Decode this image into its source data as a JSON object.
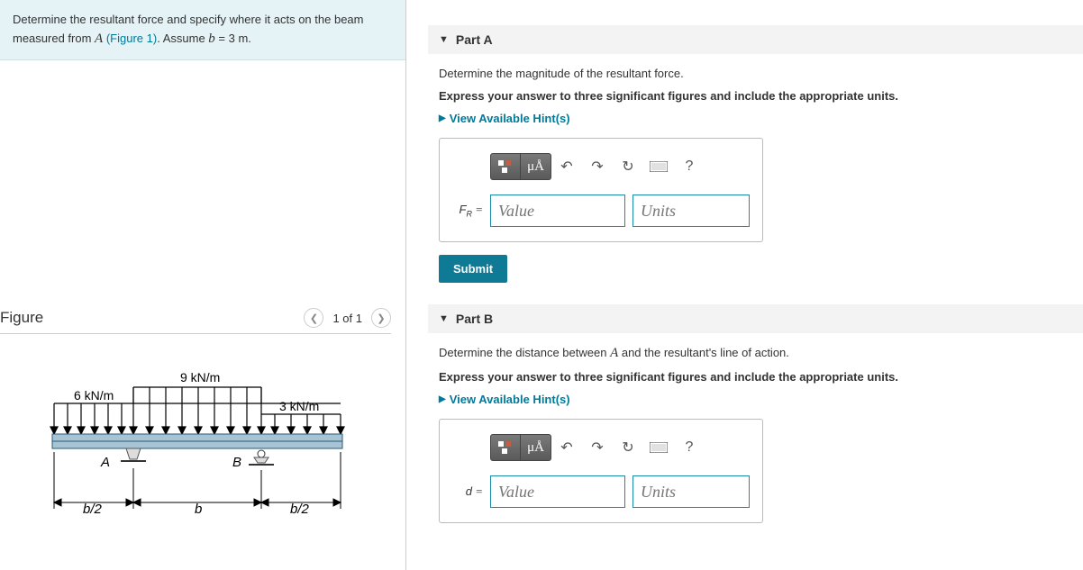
{
  "problem": {
    "text_1": "Determine the resultant force and specify where it acts on the beam measured from ",
    "fig_label": "(Figure 1)",
    "text_2": ". Assume ",
    "b_eq": "b = 3 m",
    "period": "."
  },
  "figure": {
    "title": "Figure",
    "nav_count": "1 of 1",
    "loads": {
      "left": "6 kN/m",
      "mid": "9 kN/m",
      "right": "3 kN/m"
    },
    "labels": {
      "A": "A",
      "B": "B",
      "half_b_l": "b/2",
      "b": "b",
      "half_b_r": "b/2"
    }
  },
  "partA": {
    "header": "Part A",
    "prompt": "Determine the magnitude of the resultant force.",
    "instructions": "Express your answer to three significant figures and include the appropriate units.",
    "hints": "View Available Hint(s)",
    "var_html": "F<sub>R</sub> =",
    "val_ph": "Value",
    "unit_ph": "Units",
    "submit": "Submit",
    "mu": "μÅ",
    "help": "?"
  },
  "partB": {
    "header": "Part B",
    "prompt_1": "Determine the distance between ",
    "prompt_A": "A",
    "prompt_2": " and the resultant's line of action.",
    "instructions": "Express your answer to three significant figures and include the appropriate units.",
    "hints": "View Available Hint(s)",
    "var_html": "d =",
    "val_ph": "Value",
    "unit_ph": "Units",
    "mu": "μÅ",
    "help": "?"
  }
}
